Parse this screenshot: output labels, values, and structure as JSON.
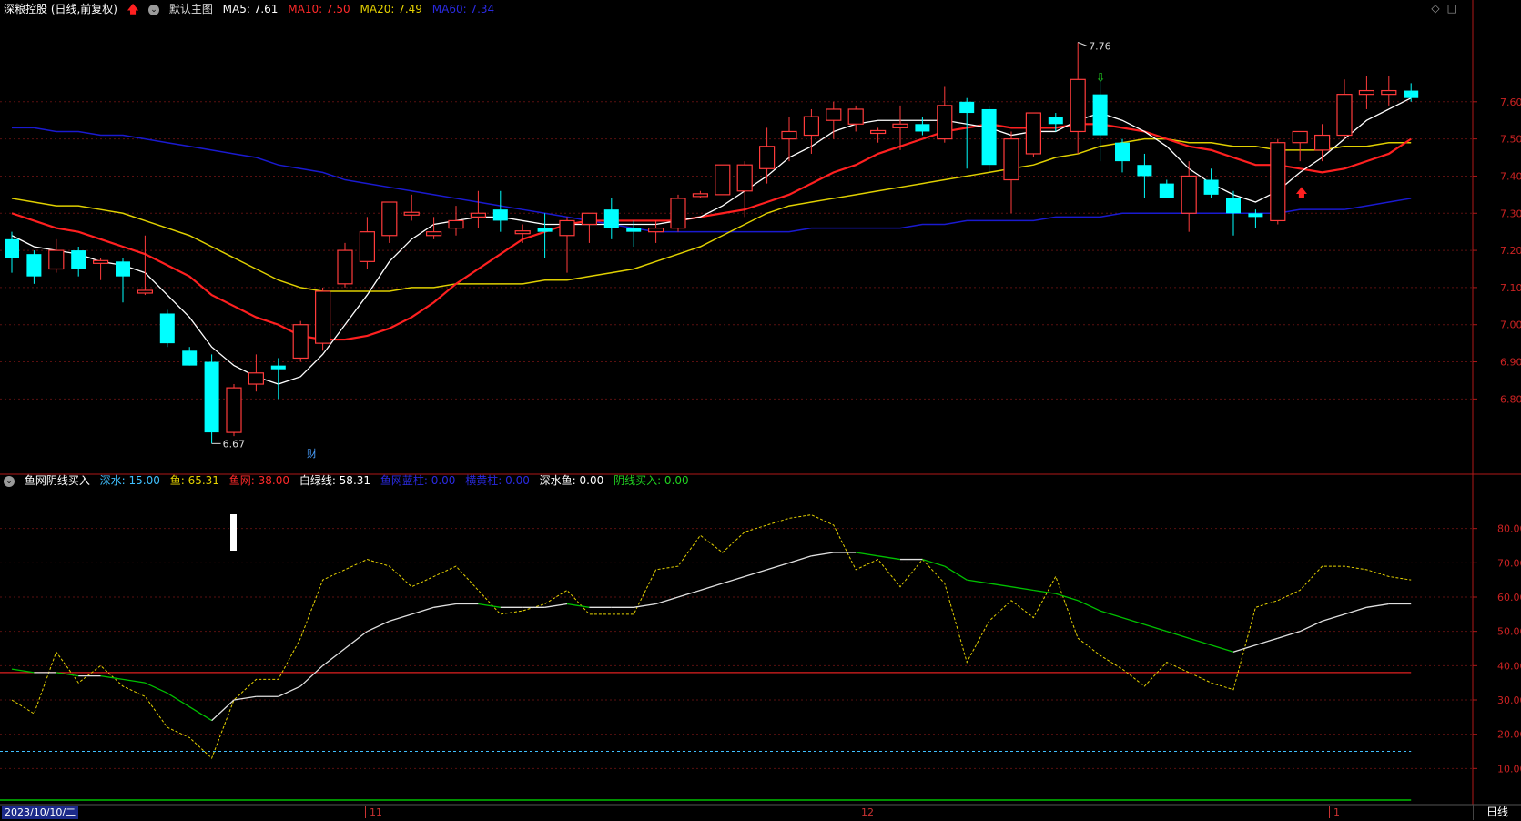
{
  "header": {
    "stock_title": "深粮控股 (日线,前复权)",
    "main_chart_label": "默认主图",
    "ma5": "MA5: 7.61",
    "ma10": "MA10: 7.50",
    "ma20": "MA20: 7.49",
    "ma60": "MA60: 7.34"
  },
  "indicator_header": {
    "name": "鱼网阴线买入",
    "shenshui": "深水: 15.00",
    "yu": "鱼: 65.31",
    "yuwang": "鱼网: 38.00",
    "bailvxian": "白绿线: 58.31",
    "yuwang_lanzhu": "鱼网蓝柱: 0.00",
    "huangzhu": "横黄柱: 0.00",
    "shenshuiyu": "深水鱼: 0.00",
    "yinxian_mairu": "阴线买入: 0.00"
  },
  "colors": {
    "up": "#ff3b3b",
    "down": "#00ffff",
    "ma5": "#ffffff",
    "ma10": "#ff2020",
    "ma20": "#e0d000",
    "ma60": "#1a1ad0",
    "axis": "#b01818",
    "indicator_yu": "#e6d200",
    "indicator_line_up": "#e0e0e0",
    "indicator_line_down": "#00c000"
  },
  "price_axis": [
    "7.60",
    "7.50",
    "7.40",
    "7.30",
    "7.20",
    "7.10",
    "7.00",
    "6.90",
    "6.80"
  ],
  "indicator_axis": [
    "80.00",
    "70.00",
    "60.00",
    "50.00",
    "40.00",
    "30.00",
    "20.00",
    "10.00"
  ],
  "annotations": {
    "high": "7.76",
    "low": "6.67",
    "cai": "财"
  },
  "bottom": {
    "date_label": "2023/10/10/二",
    "months": [
      "11",
      "12",
      "1"
    ],
    "period": "日线"
  },
  "icons": [
    "settings-circle-icon",
    "red-up-arrow-icon",
    "diamond-icon",
    "square-icon"
  ],
  "chart_data": [
    {
      "type": "candlestick",
      "title": "深粮控股 (日线,前复权)",
      "ylim": [
        6.7,
        7.8
      ],
      "candles": [
        [
          7.23,
          7.25,
          7.14,
          7.18
        ],
        [
          7.19,
          7.2,
          7.11,
          7.13
        ],
        [
          7.15,
          7.23,
          7.14,
          7.2
        ],
        [
          7.2,
          7.21,
          7.13,
          7.15
        ],
        [
          7.17,
          7.18,
          7.12,
          7.17
        ],
        [
          7.17,
          7.18,
          7.06,
          7.13
        ],
        [
          7.09,
          7.24,
          7.08,
          7.09
        ],
        [
          7.03,
          7.04,
          6.94,
          6.95
        ],
        [
          6.93,
          6.94,
          6.89,
          6.89
        ],
        [
          6.9,
          6.92,
          6.68,
          6.71
        ],
        [
          6.71,
          6.84,
          6.7,
          6.83
        ],
        [
          6.84,
          6.92,
          6.82,
          6.87
        ],
        [
          6.89,
          6.91,
          6.8,
          6.88
        ],
        [
          6.91,
          7.01,
          6.9,
          7.0
        ],
        [
          6.95,
          7.1,
          6.93,
          7.09
        ],
        [
          7.11,
          7.22,
          7.1,
          7.2
        ],
        [
          7.17,
          7.29,
          7.15,
          7.25
        ],
        [
          7.24,
          7.33,
          7.22,
          7.33
        ],
        [
          7.3,
          7.35,
          7.28,
          7.3
        ],
        [
          7.24,
          7.29,
          7.23,
          7.25
        ],
        [
          7.26,
          7.32,
          7.24,
          7.28
        ],
        [
          7.29,
          7.36,
          7.26,
          7.3
        ],
        [
          7.31,
          7.36,
          7.25,
          7.28
        ],
        [
          7.25,
          7.27,
          7.22,
          7.25
        ],
        [
          7.26,
          7.3,
          7.18,
          7.25
        ],
        [
          7.24,
          7.29,
          7.14,
          7.28
        ],
        [
          7.27,
          7.3,
          7.22,
          7.3
        ],
        [
          7.31,
          7.34,
          7.23,
          7.26
        ],
        [
          7.26,
          7.28,
          7.21,
          7.25
        ],
        [
          7.25,
          7.28,
          7.22,
          7.26
        ],
        [
          7.26,
          7.35,
          7.25,
          7.34
        ],
        [
          7.35,
          7.36,
          7.34,
          7.35
        ],
        [
          7.35,
          7.43,
          7.35,
          7.43
        ],
        [
          7.36,
          7.44,
          7.29,
          7.43
        ],
        [
          7.42,
          7.53,
          7.38,
          7.48
        ],
        [
          7.5,
          7.56,
          7.44,
          7.52
        ],
        [
          7.51,
          7.58,
          7.46,
          7.56
        ],
        [
          7.55,
          7.6,
          7.5,
          7.58
        ],
        [
          7.54,
          7.59,
          7.52,
          7.58
        ],
        [
          7.52,
          7.53,
          7.49,
          7.52
        ],
        [
          7.53,
          7.59,
          7.47,
          7.54
        ],
        [
          7.54,
          7.56,
          7.51,
          7.52
        ],
        [
          7.5,
          7.64,
          7.49,
          7.59
        ],
        [
          7.6,
          7.61,
          7.42,
          7.57
        ],
        [
          7.58,
          7.59,
          7.41,
          7.43
        ],
        [
          7.39,
          7.52,
          7.3,
          7.5
        ],
        [
          7.46,
          7.57,
          7.45,
          7.57
        ],
        [
          7.56,
          7.57,
          7.52,
          7.54
        ],
        [
          7.52,
          7.76,
          7.46,
          7.66
        ],
        [
          7.62,
          7.66,
          7.44,
          7.51
        ],
        [
          7.49,
          7.5,
          7.41,
          7.44
        ],
        [
          7.43,
          7.46,
          7.34,
          7.4
        ],
        [
          7.38,
          7.39,
          7.35,
          7.34
        ],
        [
          7.3,
          7.44,
          7.25,
          7.4
        ],
        [
          7.39,
          7.42,
          7.34,
          7.35
        ],
        [
          7.34,
          7.36,
          7.24,
          7.3
        ],
        [
          7.3,
          7.31,
          7.26,
          7.29
        ],
        [
          7.28,
          7.5,
          7.27,
          7.49
        ],
        [
          7.49,
          7.52,
          7.44,
          7.52
        ],
        [
          7.47,
          7.54,
          7.44,
          7.51
        ],
        [
          7.51,
          7.66,
          7.5,
          7.62
        ],
        [
          7.62,
          7.67,
          7.58,
          7.63
        ],
        [
          7.62,
          7.67,
          7.59,
          7.63
        ],
        [
          7.63,
          7.65,
          7.6,
          7.61
        ]
      ],
      "ma_lines": {
        "MA5": [
          7.24,
          7.21,
          7.2,
          7.19,
          7.17,
          7.16,
          7.14,
          7.08,
          7.02,
          6.94,
          6.89,
          6.86,
          6.84,
          6.86,
          6.92,
          7.0,
          7.08,
          7.17,
          7.23,
          7.27,
          7.28,
          7.29,
          7.29,
          7.28,
          7.27,
          7.27,
          7.27,
          7.27,
          7.27,
          7.27,
          7.28,
          7.29,
          7.32,
          7.36,
          7.4,
          7.45,
          7.48,
          7.52,
          7.54,
          7.55,
          7.55,
          7.55,
          7.55,
          7.54,
          7.53,
          7.51,
          7.52,
          7.52,
          7.55,
          7.57,
          7.55,
          7.52,
          7.48,
          7.42,
          7.38,
          7.35,
          7.33,
          7.36,
          7.41,
          7.45,
          7.5,
          7.55,
          7.58,
          7.61
        ],
        "MA10": [
          7.3,
          7.28,
          7.26,
          7.25,
          7.23,
          7.21,
          7.19,
          7.16,
          7.13,
          7.08,
          7.05,
          7.02,
          7.0,
          6.97,
          6.96,
          6.96,
          6.97,
          6.99,
          7.02,
          7.06,
          7.11,
          7.15,
          7.19,
          7.23,
          7.25,
          7.27,
          7.28,
          7.28,
          7.28,
          7.28,
          7.28,
          7.29,
          7.3,
          7.31,
          7.33,
          7.35,
          7.38,
          7.41,
          7.43,
          7.46,
          7.48,
          7.5,
          7.52,
          7.53,
          7.54,
          7.53,
          7.53,
          7.53,
          7.54,
          7.54,
          7.53,
          7.52,
          7.5,
          7.48,
          7.47,
          7.45,
          7.43,
          7.43,
          7.42,
          7.41,
          7.42,
          7.44,
          7.46,
          7.5
        ],
        "MA20": [
          7.34,
          7.33,
          7.32,
          7.32,
          7.31,
          7.3,
          7.28,
          7.26,
          7.24,
          7.21,
          7.18,
          7.15,
          7.12,
          7.1,
          7.09,
          7.09,
          7.09,
          7.09,
          7.1,
          7.1,
          7.11,
          7.11,
          7.11,
          7.11,
          7.12,
          7.12,
          7.13,
          7.14,
          7.15,
          7.17,
          7.19,
          7.21,
          7.24,
          7.27,
          7.3,
          7.32,
          7.33,
          7.34,
          7.35,
          7.36,
          7.37,
          7.38,
          7.39,
          7.4,
          7.41,
          7.42,
          7.43,
          7.45,
          7.46,
          7.48,
          7.49,
          7.5,
          7.5,
          7.49,
          7.49,
          7.48,
          7.48,
          7.47,
          7.47,
          7.47,
          7.48,
          7.48,
          7.49,
          7.49
        ],
        "MA60": [
          7.53,
          7.53,
          7.52,
          7.52,
          7.51,
          7.51,
          7.5,
          7.49,
          7.48,
          7.47,
          7.46,
          7.45,
          7.43,
          7.42,
          7.41,
          7.39,
          7.38,
          7.37,
          7.36,
          7.35,
          7.34,
          7.33,
          7.32,
          7.31,
          7.3,
          7.29,
          7.28,
          7.27,
          7.26,
          7.25,
          7.25,
          7.25,
          7.25,
          7.25,
          7.25,
          7.25,
          7.26,
          7.26,
          7.26,
          7.26,
          7.26,
          7.27,
          7.27,
          7.28,
          7.28,
          7.28,
          7.28,
          7.29,
          7.29,
          7.29,
          7.3,
          7.3,
          7.3,
          7.3,
          7.3,
          7.3,
          7.3,
          7.3,
          7.31,
          7.31,
          7.31,
          7.32,
          7.33,
          7.34
        ]
      }
    },
    {
      "type": "line",
      "title": "鱼网阴线买入",
      "ylim": [
        0,
        90
      ],
      "series": [
        {
          "name": "鱼",
          "values": [
            30,
            26,
            44,
            35,
            40,
            34,
            31,
            22,
            19,
            13,
            30,
            36,
            36,
            48,
            65,
            68,
            71,
            69,
            63,
            66,
            69,
            62,
            55,
            56,
            58,
            62,
            55,
            55,
            55,
            68,
            69,
            78,
            73,
            79,
            81,
            83,
            84,
            81,
            68,
            71,
            63,
            71,
            64,
            41,
            53,
            59,
            54,
            66,
            48,
            43,
            39,
            34,
            41,
            38,
            35,
            33,
            57,
            59,
            62,
            69,
            69,
            68,
            66,
            65
          ]
        },
        {
          "name": "白绿线",
          "values": [
            39,
            38,
            38,
            37,
            37,
            36,
            35,
            32,
            28,
            24,
            30,
            31,
            31,
            34,
            40,
            45,
            50,
            53,
            55,
            57,
            58,
            58,
            57,
            57,
            57,
            58,
            57,
            57,
            57,
            58,
            60,
            62,
            64,
            66,
            68,
            70,
            72,
            73,
            73,
            72,
            71,
            71,
            69,
            65,
            64,
            63,
            62,
            61,
            59,
            56,
            54,
            52,
            50,
            48,
            46,
            44,
            46,
            48,
            50,
            53,
            55,
            57,
            58,
            58
          ]
        },
        {
          "name": "鱼网",
          "values": [
            38,
            38,
            38,
            38,
            38,
            38,
            38,
            38,
            38,
            38,
            38,
            38,
            38,
            38,
            38,
            38,
            38,
            38,
            38,
            38,
            38,
            38,
            38,
            38,
            38,
            38,
            38,
            38,
            38,
            38,
            38,
            38,
            38,
            38,
            38,
            38,
            38,
            38,
            38,
            38,
            38,
            38,
            38,
            38,
            38,
            38,
            38,
            38,
            38,
            38,
            38,
            38,
            38,
            38,
            38,
            38,
            38,
            38,
            38,
            38,
            38,
            38,
            38,
            38
          ]
        },
        {
          "name": "深水",
          "values": [
            15,
            15,
            15,
            15,
            15,
            15,
            15,
            15,
            15,
            15,
            15,
            15,
            15,
            15,
            15,
            15,
            15,
            15,
            15,
            15,
            15,
            15,
            15,
            15,
            15,
            15,
            15,
            15,
            15,
            15,
            15,
            15,
            15,
            15,
            15,
            15,
            15,
            15,
            15,
            15,
            15,
            15,
            15,
            15,
            15,
            15,
            15,
            15,
            15,
            15,
            15,
            15,
            15,
            15,
            15,
            15,
            15,
            15,
            15,
            15,
            15,
            15,
            15,
            15
          ]
        }
      ]
    }
  ]
}
